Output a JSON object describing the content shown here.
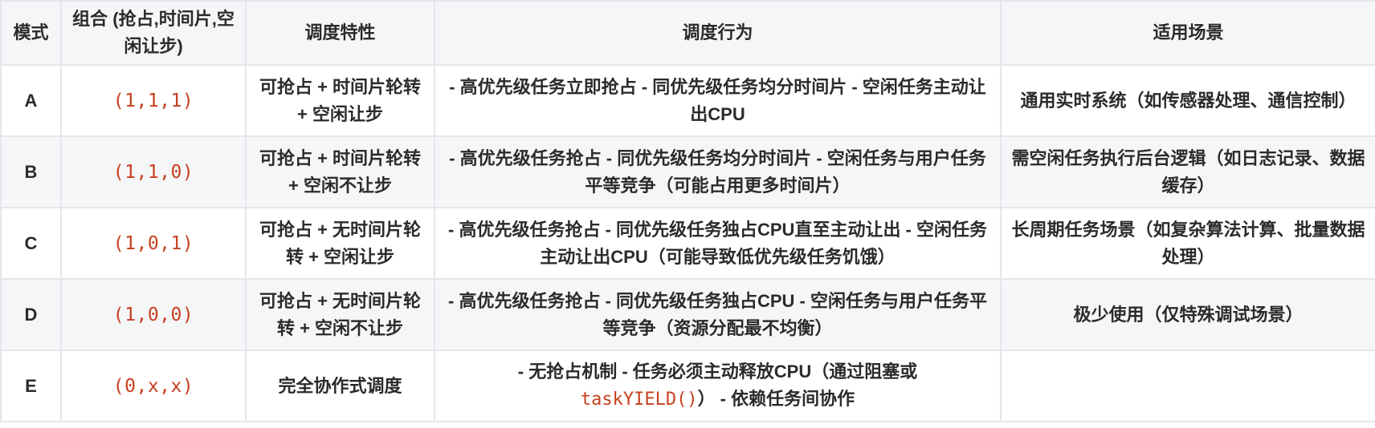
{
  "header": {
    "mode": "模式",
    "combo": "组合 (抢占,时间片,空闲让步)",
    "traits": "调度特性",
    "behavior": "调度行为",
    "scenario": "适用场景"
  },
  "rows": [
    {
      "mode": "A",
      "combo": "(1,1,1)",
      "traits": "可抢占 + 时间片轮转 + 空闲让步",
      "behavior": "- 高优先级任务立即抢占 - 同优先级任务均分时间片 - 空闲任务主动让出CPU",
      "scenario": "通用实时系统（如传感器处理、通信控制）"
    },
    {
      "mode": "B",
      "combo": "(1,1,0)",
      "traits": "可抢占 + 时间片轮转 + 空闲不让步",
      "behavior": "- 高优先级任务抢占 - 同优先级任务均分时间片 - 空闲任务与用户任务平等竞争（可能占用更多时间片）",
      "scenario": "需空闲任务执行后台逻辑（如日志记录、数据缓存）"
    },
    {
      "mode": "C",
      "combo": "(1,0,1)",
      "traits": "可抢占 + 无时间片轮转 + 空闲让步",
      "behavior": "- 高优先级任务抢占 - 同优先级任务独占CPU直至主动让出 - 空闲任务主动让出CPU（可能导致低优先级任务饥饿）",
      "scenario": "长周期任务场景（如复杂算法计算、批量数据处理）"
    },
    {
      "mode": "D",
      "combo": "(1,0,0)",
      "traits": "可抢占 + 无时间片轮转 + 空闲不让步",
      "behavior": "- 高优先级任务抢占 - 同优先级任务独占CPU - 空闲任务与用户任务平等竞争（资源分配最不均衡）",
      "scenario": "极少使用（仅特殊调试场景）"
    },
    {
      "mode": "E",
      "combo": "(0,x,x)",
      "traits": "完全协作式调度",
      "behavior_pre": "- 无抢占机制 - 任务必须主动释放CPU（通过阻塞或",
      "behavior_code": "taskYIELD()",
      "behavior_post": "） - 依赖任务间协作",
      "scenario": ""
    }
  ],
  "colors": {
    "header_bg": "#f5f6f8",
    "alt_row_bg": "#f5f6f8",
    "border": "#e3e6ea",
    "text": "#2b2b2b",
    "code_accent": "#c7401e"
  }
}
